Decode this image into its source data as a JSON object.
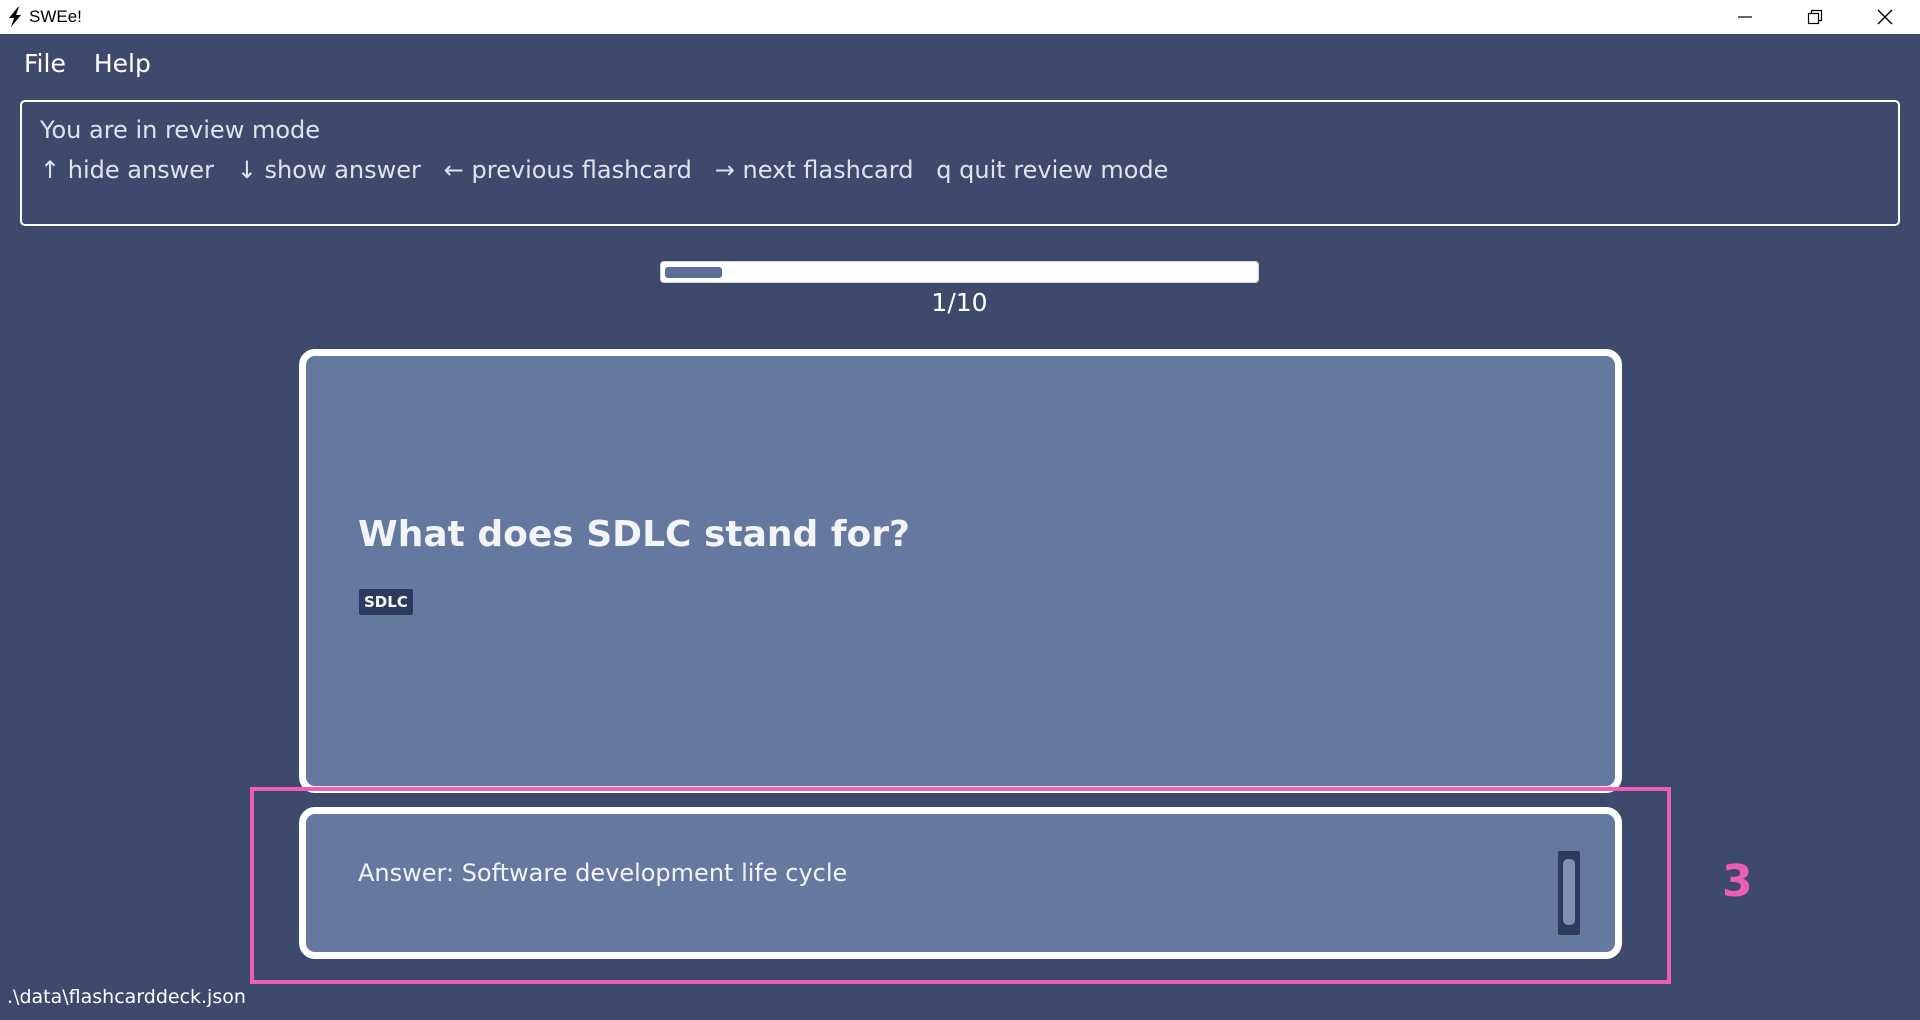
{
  "window": {
    "title": "SWEe!",
    "controls": [
      "minimize-icon",
      "restore-icon",
      "close-icon"
    ]
  },
  "menu": {
    "items": [
      "File",
      "Help"
    ]
  },
  "result_display": {
    "line1": "You are in review mode",
    "line2": "↑ hide answer   ↓ show answer   ← previous flashcard   → next flashcard   q quit review mode"
  },
  "progress": {
    "label": "1/10",
    "current": 1,
    "total": 10
  },
  "flashcard": {
    "question": "What does SDLC stand for?",
    "tags": [
      "SDLC"
    ],
    "answer": "Answer: Software development life cycle"
  },
  "annotation": {
    "callout_number": "3",
    "color": "#ee5eb8"
  },
  "status_bar": {
    "file_path": ".\\data\\flashcarddeck.json"
  },
  "colors": {
    "background": "#3d4a6b",
    "card": "#65789f",
    "tag": "#2b3a5e",
    "progress_fill": "#5b6d96"
  }
}
